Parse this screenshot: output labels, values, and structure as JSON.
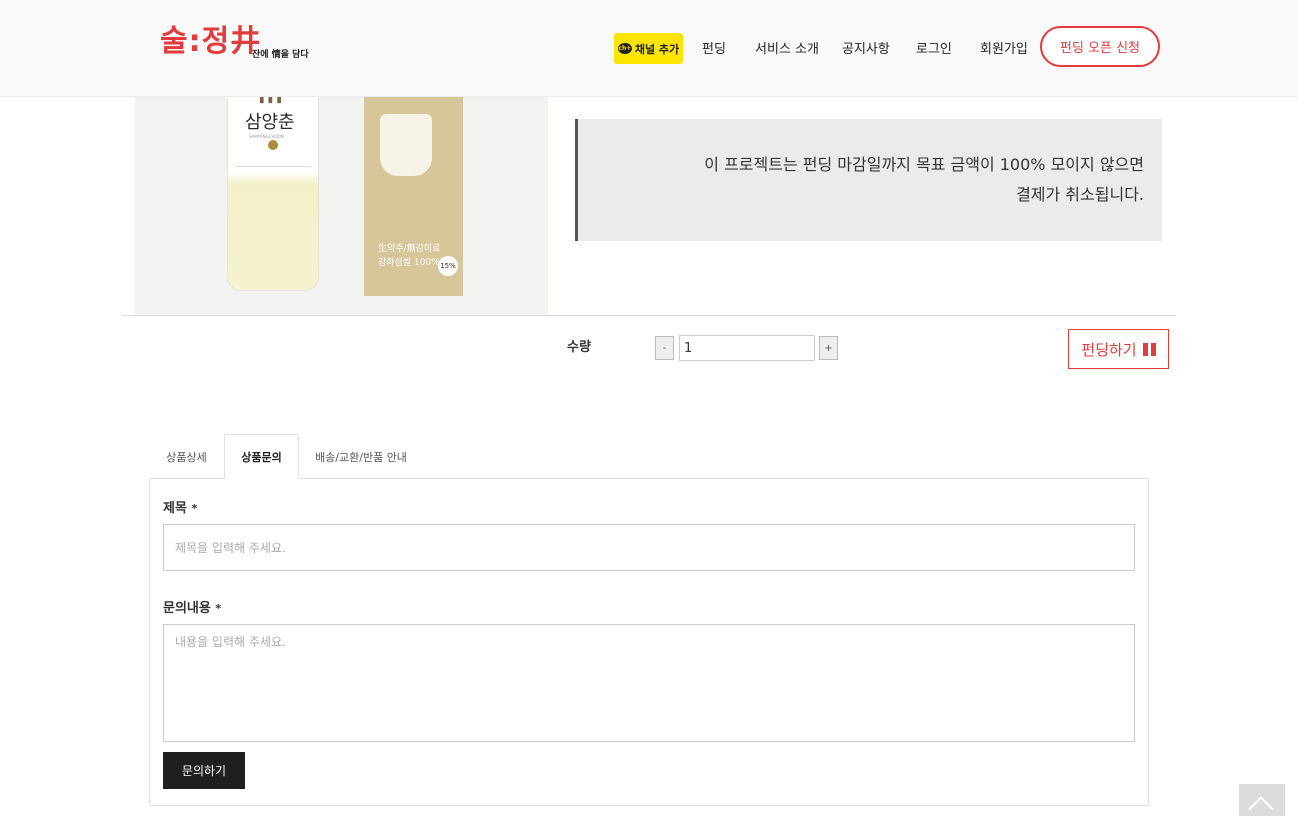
{
  "header": {
    "logo": {
      "main": "술:정井",
      "tagline": "잔에 情을 담다"
    },
    "channel_add": {
      "icon": "kakao-talk-channel-icon",
      "label": "채널 추가",
      "icon_text": "ch+",
      "color": "#fee500"
    },
    "nav": [
      "펀딩",
      "서비스 소개",
      "공지사항",
      "로그인",
      "회원가입"
    ],
    "open_button": "펀딩 오픈 신청",
    "accent_color": "#e23b3b"
  },
  "product": {
    "bottle_name": "삼양춘",
    "bottle_eng": "SAMYANGCHOON",
    "box_text": [
      "生약주/無감미료",
      "강화섬쌀 100%"
    ],
    "abv_badge": "15%"
  },
  "notice": {
    "line1": "이 프로젝트는 펀딩 마감일까지 목표 금액이 100% 모이지 않으면",
    "line2": "결제가 취소됩니다."
  },
  "order": {
    "qty_label": "수량",
    "minus": "-",
    "plus": "+",
    "qty_value": "1",
    "fund_button": "펀딩하기",
    "fund_icon": "gift-icon"
  },
  "tabs": [
    "상품상세",
    "상품문의",
    "배송/교환/반품 안내"
  ],
  "active_tab": "상품문의",
  "inquiry": {
    "title_label": "제목",
    "required_mark": "*",
    "title_placeholder": "제목을 입력해 주세요.",
    "content_label": "문의내용",
    "content_placeholder": "내용을 입력해 주세요.",
    "submit": "문의하기"
  },
  "scroll_top_icon": "chevron-up-icon"
}
